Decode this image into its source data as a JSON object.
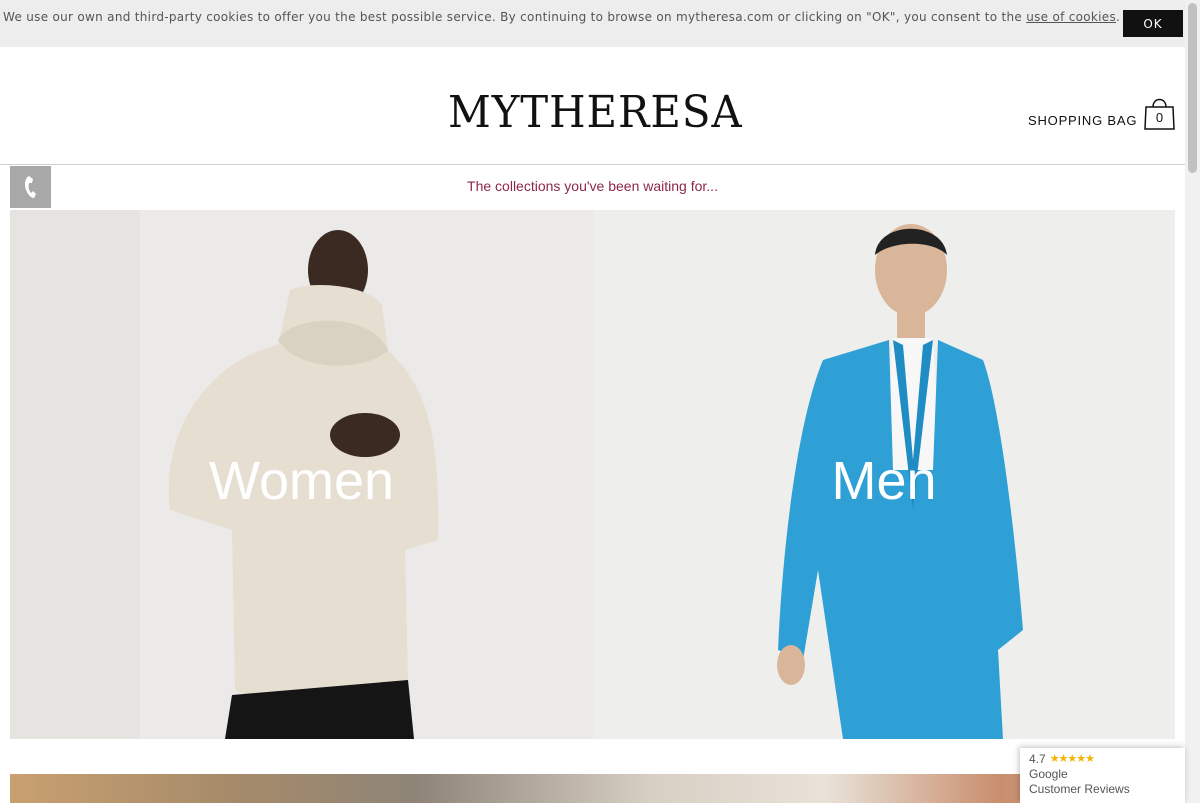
{
  "cookie_bar": {
    "text": "We use our own and third-party cookies to offer you the best possible service. By continuing to browse on mytheresa.com or clicking on \"OK\", you consent to the ",
    "link": "use of cookies",
    "suffix": ".",
    "ok_label": "OK"
  },
  "header": {
    "logo": "MYTHERESA",
    "bag_label": "SHOPPING BAG",
    "bag_count": "0"
  },
  "promo": {
    "text": "The collections you've been waiting for..."
  },
  "panels": [
    {
      "label": "Women"
    },
    {
      "label": "Men"
    }
  ],
  "reviews": {
    "rating": "4.7",
    "stars": "★★★★★",
    "brand": "Google",
    "label": "Customer Reviews"
  },
  "colors": {
    "promo_text": "#8b2847",
    "ok_button": "#111111",
    "cookie_bg": "#ededed"
  }
}
